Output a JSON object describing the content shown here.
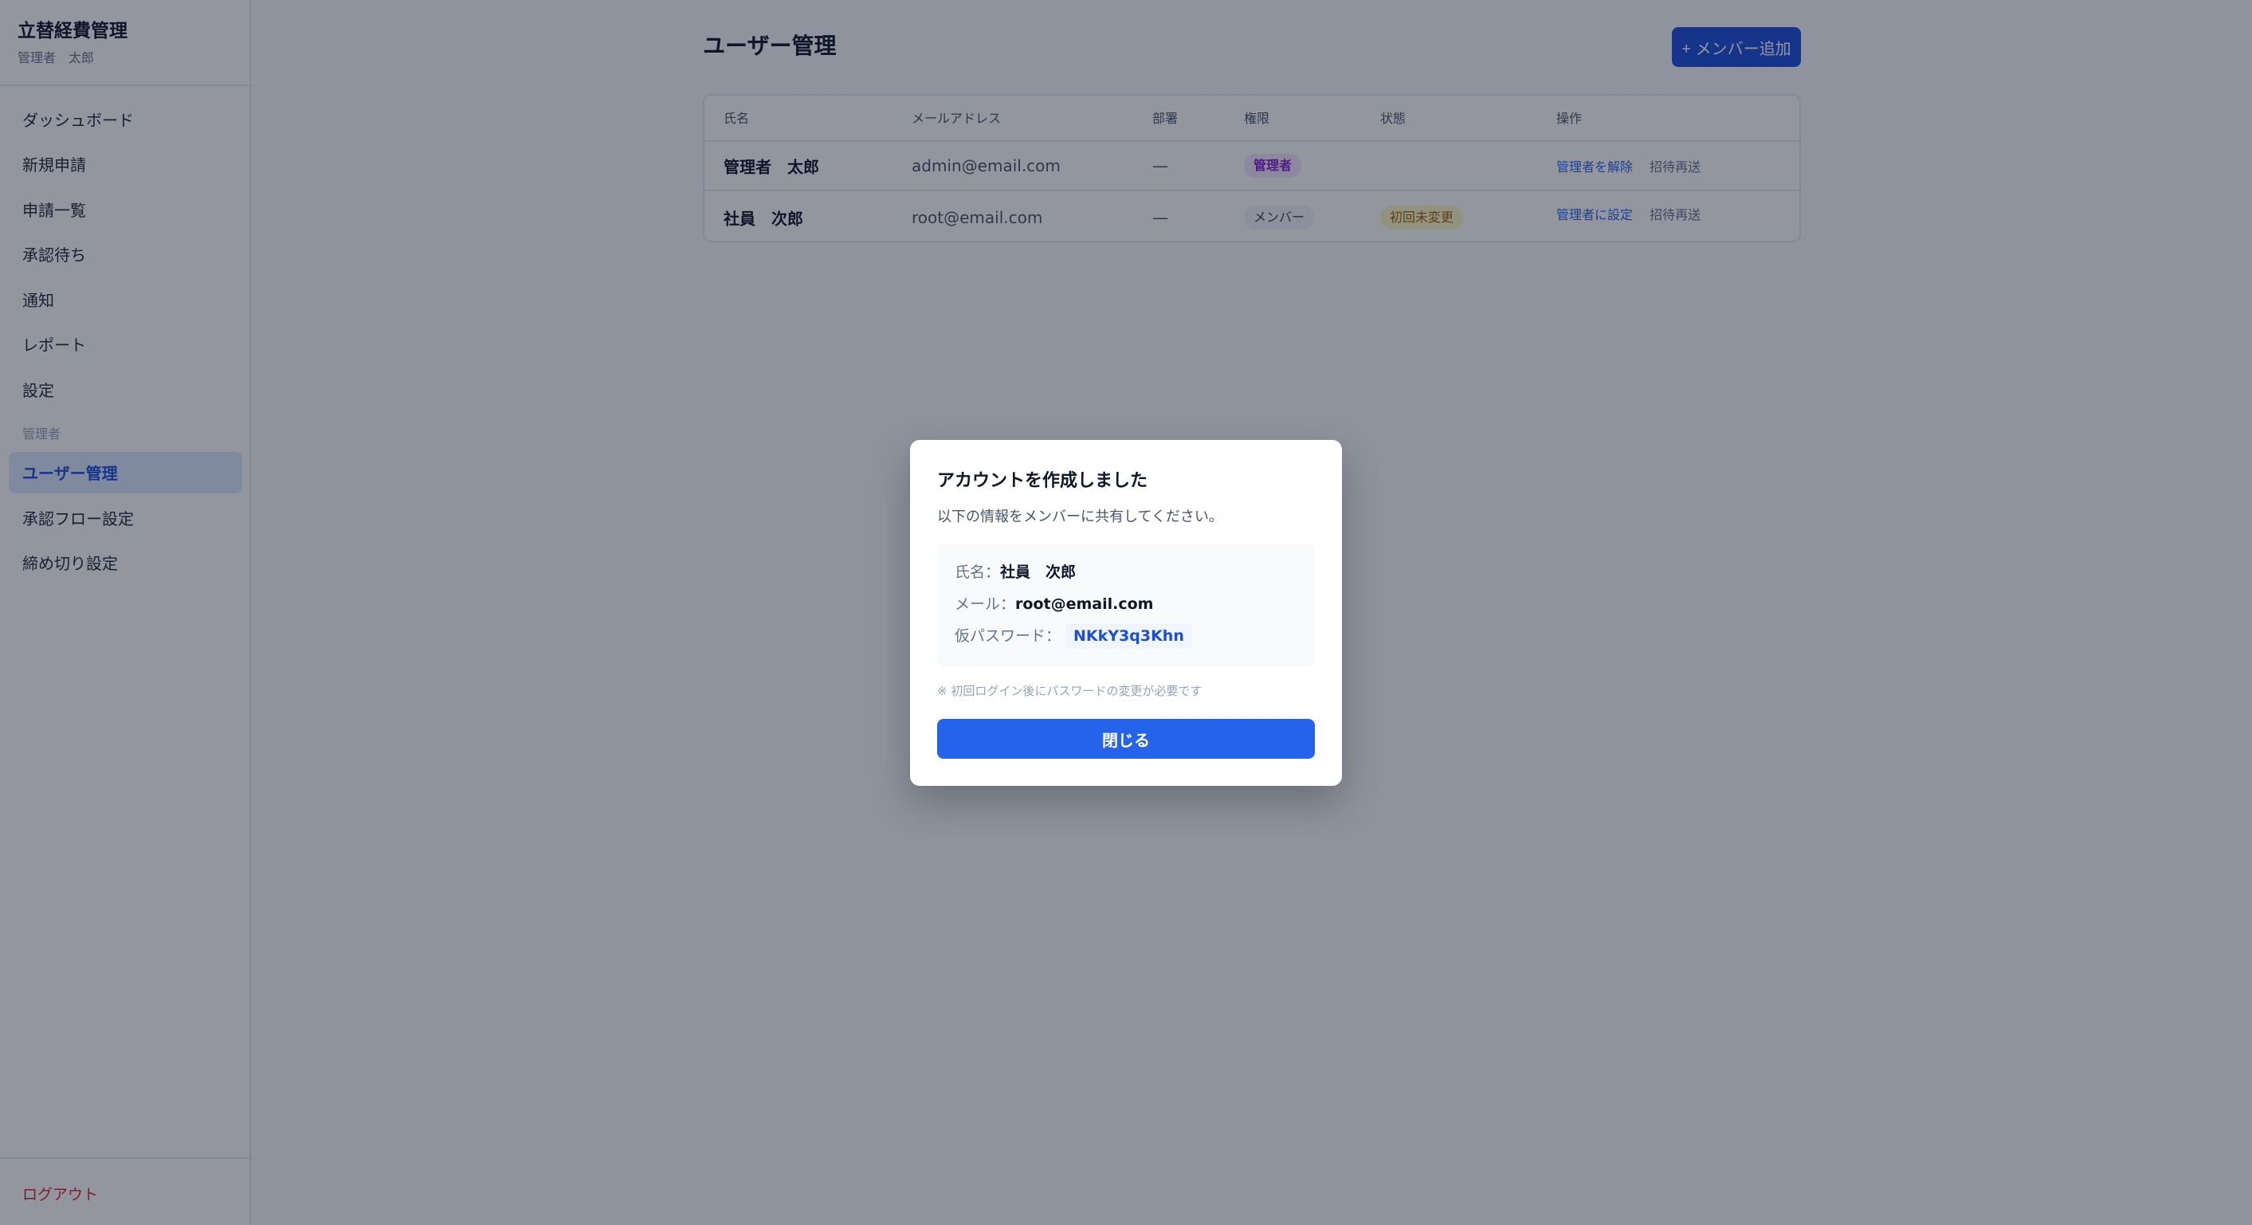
{
  "sidebar": {
    "app_title": "立替経費管理",
    "user_name": "管理者　太郎",
    "items": [
      {
        "label": "ダッシュボード"
      },
      {
        "label": "新規申請"
      },
      {
        "label": "申請一覧"
      },
      {
        "label": "承認待ち"
      },
      {
        "label": "通知"
      },
      {
        "label": "レポート"
      },
      {
        "label": "設定"
      }
    ],
    "admin_section_label": "管理者",
    "admin_items": [
      {
        "label": "ユーザー管理",
        "active": true
      },
      {
        "label": "承認フロー設定"
      },
      {
        "label": "締め切り設定"
      }
    ],
    "logout_label": "ログアウト"
  },
  "main": {
    "page_title": "ユーザー管理",
    "add_member_label": "+ メンバー追加",
    "table": {
      "headers": [
        "氏名",
        "メールアドレス",
        "部署",
        "権限",
        "状態",
        "操作"
      ],
      "rows": [
        {
          "name": "管理者　太郎",
          "email": "admin@email.com",
          "dept": "—",
          "role": "管理者",
          "status": "",
          "action": "管理者を解除",
          "resend": "招待再送"
        },
        {
          "name": "社員　次郎",
          "email": "root@email.com",
          "dept": "—",
          "role": "メンバー",
          "status": "初回未変更",
          "action": "管理者に設定",
          "resend": "招待再送"
        }
      ]
    }
  },
  "modal": {
    "title": "アカウントを作成しました",
    "description": "以下の情報をメンバーに共有してください。",
    "name_label": "氏名：",
    "name_value": "社員　次郎",
    "email_label": "メール：",
    "email_value": "root@email.com",
    "password_label": "仮パスワード：",
    "password_value": "NKkY3q3Khn",
    "note": "※ 初回ログイン後にパスワードの変更が必要です",
    "close_label": "閉じる"
  },
  "colors": {
    "accent": "#2563eb",
    "admin_badge": "#7e22ce",
    "status_badge": "#a16207",
    "logout": "#dc2626"
  }
}
